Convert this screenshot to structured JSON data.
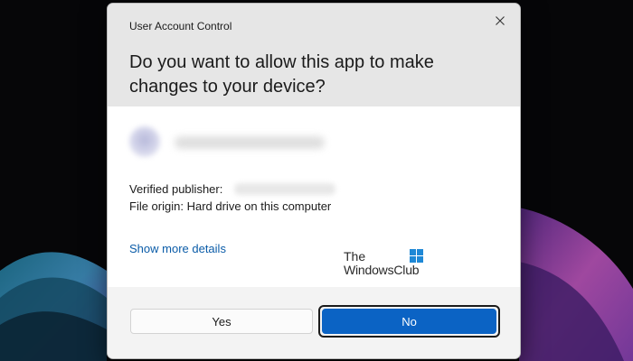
{
  "dialog": {
    "title": "User Account Control",
    "question": "Do you want to allow this app to make changes to your device?",
    "verified_publisher_label": "Verified publisher:",
    "file_origin": "File origin: Hard drive on this computer",
    "show_more_details": "Show more details",
    "buttons": {
      "yes": "Yes",
      "no": "No"
    },
    "close_icon": "close-icon"
  },
  "watermark": {
    "line1": "The",
    "line2": "WindowsClub"
  },
  "colors": {
    "header_bg": "#e6e6e6",
    "footer_bg": "#f3f3f3",
    "accent": "#0b63c4",
    "link": "#0b5ca8"
  }
}
